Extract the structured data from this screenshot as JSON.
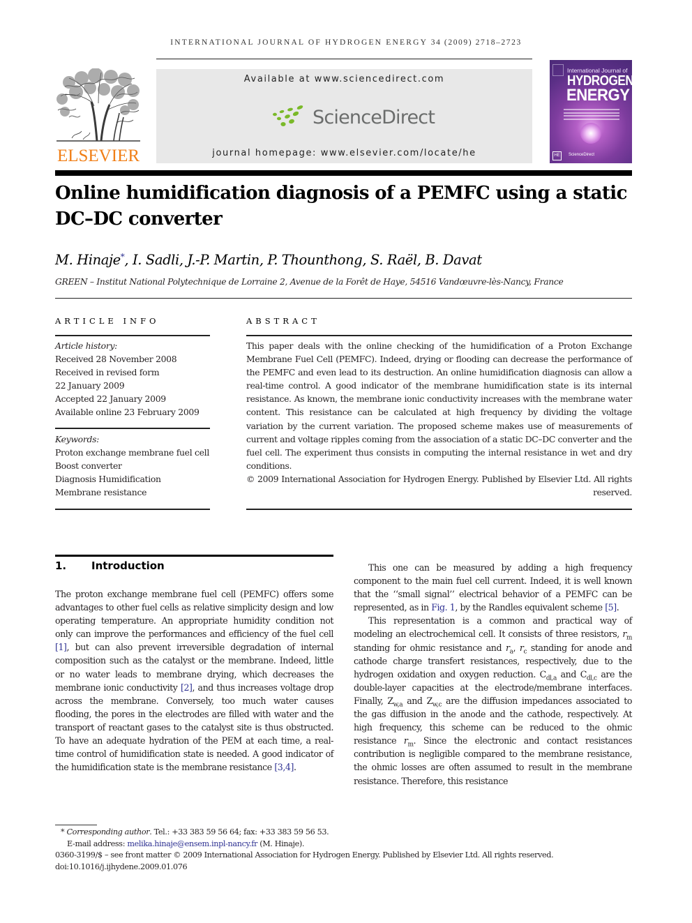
{
  "running_head": {
    "journal": "International Journal of Hydrogen Energy",
    "issue": "34 (2009) 2718–2723"
  },
  "publisher_banner": {
    "elsevier_logo_text": "ELSEVIER",
    "available_at": "Available at www.sciencedirect.com",
    "sciencedirect_logo_text": "ScienceDirect",
    "journal_homepage": "journal homepage: www.elsevier.com/locate/he",
    "colors": {
      "elsevier_orange": "#f07f17",
      "sciencedirect_green": "#7ab929",
      "banner_gray": "#e8e8e8",
      "link_blue": "#2e3192"
    }
  },
  "journal_cover": {
    "line1": "International Journal of",
    "line2": "HYDROGEN",
    "line3": "ENERGY",
    "badge": "HE",
    "footer": "ScienceDirect"
  },
  "article": {
    "title": "Online humidification diagnosis of a PEMFC using a static DC–DC converter",
    "authors": "M. Hinaje",
    "authors_mark": "*",
    "authors_rest": ", I. Sadli, J.-P. Martin, P. Thounthong, S. Raël, B. Davat",
    "affiliation": "GREEN – Institut National Polytechnique de Lorraine 2, Avenue de la Forêt de Haye, 54516 Vandœuvre-lès-Nancy, France"
  },
  "article_info": {
    "heading": "Article info",
    "history_label": "Article history:",
    "history": [
      "Received 28 November 2008",
      "Received in revised form",
      "22 January 2009",
      "Accepted 22 January 2009",
      "Available online 23 February 2009"
    ],
    "keywords_label": "Keywords:",
    "keywords": [
      "Proton exchange membrane fuel cell",
      "Boost converter",
      "Diagnosis Humidification",
      "Membrane resistance"
    ]
  },
  "abstract": {
    "heading": "Abstract",
    "text": "This paper deals with the online checking of the humidification of a Proton Exchange Membrane Fuel Cell (PEMFC). Indeed, drying or flooding can decrease the performance of the PEMFC and even lead to its destruction. An online humidification diagnosis can allow a real-time control. A good indicator of the membrane humidification state is its internal resistance. As known, the membrane ionic conductivity increases with the membrane water content. This resistance can be calculated at high frequency by dividing the voltage variation by the current variation. The proposed scheme makes use of measurements of current and voltage ripples coming from the association of a static DC–DC converter and the fuel cell. The experiment thus consists in computing the internal resistance in wet and dry conditions.",
    "copyright": "© 2009 International Association for Hydrogen Energy. Published by Elsevier Ltd. All rights reserved."
  },
  "introduction": {
    "number": "1.",
    "heading": "Introduction",
    "left_column": {
      "s1": "The proton exchange membrane fuel cell (PEMFC) offers some advantages to other fuel cells as relative simplicity design and low operating temperature. An appropriate humidity condition not only can improve the performances and efficiency of the fuel cell ",
      "r1": "[1]",
      "s2": ", but can also prevent irreversible degradation of internal composition such as the catalyst or the membrane. Indeed, little or no water leads to membrane drying, which decreases the membrane ionic conductivity ",
      "r2": "[2]",
      "s3": ", and thus increases voltage drop across the membrane. Conversely, too much water causes flooding, the pores in the electrodes are filled with water and the transport of reactant gases to the catalyst site is thus obstructed. To have an adequate hydration of the PEM at each time, a real-time control of humidification state is needed. A good indicator of the humidification state is the membrane resistance ",
      "r3": "[3,4]",
      "s4": "."
    },
    "right_column": {
      "p1_a": "This one can be measured by adding a high frequency component to the main fuel cell current. Indeed, it is well known that the ‘‘small signal’’ electrical behavior of a PEMFC can be represented, as in ",
      "p1_fig": "Fig. 1",
      "p1_b": ", by the Randles equivalent scheme ",
      "p1_ref": "[5]",
      "p1_c": ".",
      "p2_a": "This representation is a common and practical way of modeling an electrochemical cell. It consists of three resistors, ",
      "r": "r",
      "sub_m": "m",
      "p2_b": " standing for ohmic resistance and ",
      "sub_a": "a",
      "comma": ", ",
      "sub_c": "c",
      "p2_c": " standing for anode and cathode charge transfert resistances, respectively, due to the hydrogen oxidation and oxygen reduction. ",
      "C": "C",
      "sub_dla": "dl,a",
      "and": " and ",
      "sub_dlc": "dl,c",
      "p2_d": " are the double-layer capacities at the electrode/membrane interfaces. Finally, ",
      "Z": "Z",
      "sub_wa": "w,a",
      "sub_wc": "w,c",
      "p2_e": " are the diffusion impedances associated to the gas diffusion in the anode and the cathode, respectively. At high frequency, this scheme can be reduced to the ohmic resistance ",
      "p2_f": ". Since the electronic and contact resistances contribution is negligible compared to the membrane resistance, the ohmic losses are often assumed to result in the membrane resistance. Therefore, this resistance"
    }
  },
  "footnotes": {
    "mark": "*",
    "corresponding_label": "Corresponding author",
    "contact": ". Tel.: +33 383 59 56 64; fax: +33 383 59 56 53.",
    "email_label": "E-mail address: ",
    "email": "melika.hinaje@ensem.inpl-nancy.fr",
    "email_owner": " (M. Hinaje).",
    "front_matter": "0360-3199/$ – see front matter © 2009 International Association for Hydrogen Energy. Published by Elsevier Ltd. All rights reserved.",
    "doi": "doi:10.1016/j.ijhydene.2009.01.076"
  }
}
